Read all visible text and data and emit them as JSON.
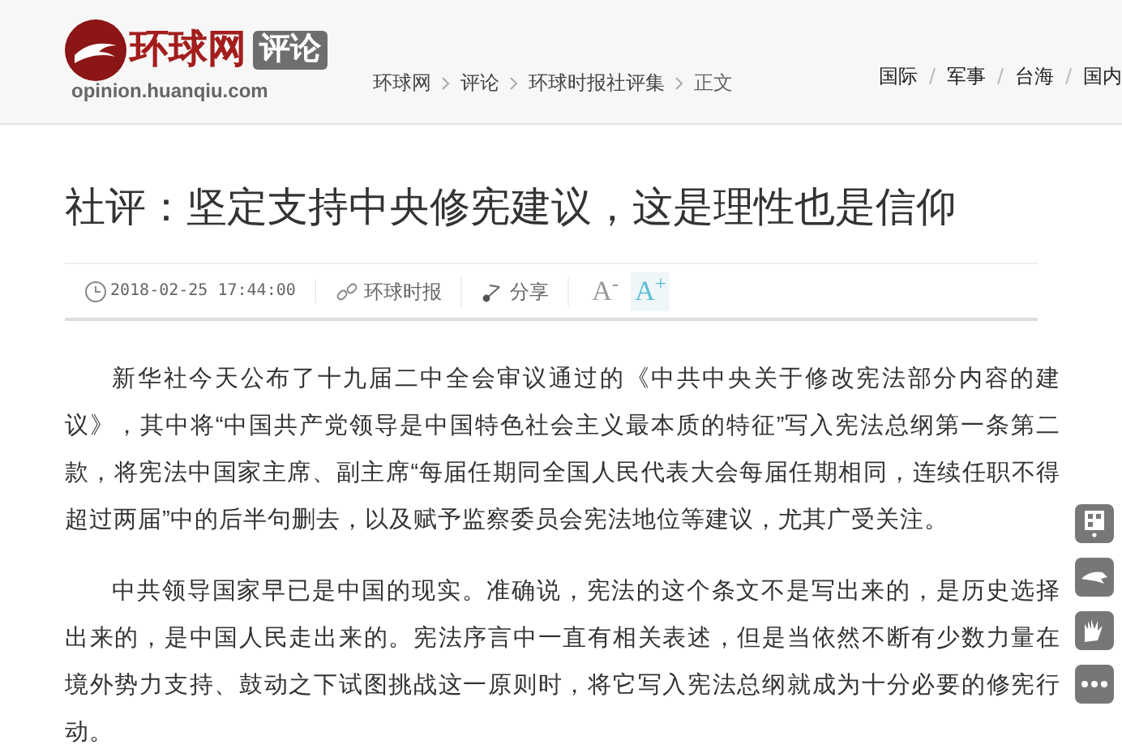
{
  "header": {
    "logo": {
      "name": "环球网",
      "badge": "评论",
      "domain": "opinion.huanqiu.com"
    },
    "breadcrumb": [
      "环球网",
      "评论",
      "环球时报社评集",
      "正文"
    ],
    "nav": [
      "国际",
      "军事",
      "台海",
      "国内"
    ]
  },
  "article": {
    "title": "社评：坚定支持中央修宪建议，这是理性也是信仰",
    "meta": {
      "time": "2018-02-25 17:44:00",
      "source": "环球时报",
      "share": "分享",
      "font_sizes": [
        {
          "label": "A$^{-}$",
          "selected": false
        },
        {
          "label": "A$^{+}$",
          "selected": true
        }
      ]
    },
    "paragraphs": [
      "新华社今天公布了十九届二中全会审议通过的《中共中央关于修改宪法部分内容的建议》，其中将“中国共产党领导是中国特色社会主义最本质的特征”写入宪法总纲第一条第二款，将宪法中国家主席、副主席“每届任期同全国人民代表大会每届任期相同，连续任职不得超过两届”中的后半句删去，以及赋予监察委员会宪法地位等建议，尤其广受关注。",
      "中共领导国家早已是中国的现实。准确说，宪法的这个条文不是写出来的，是历史选择出来的，是中国人民走出来的。宪法序言中一直有相关表述，但是当依然不断有少数力量在境外势力支持、鼓动之下试图挑战这一原则时，将它写入宪法总纲就成为十分必要的修宪行动。"
    ]
  }
}
